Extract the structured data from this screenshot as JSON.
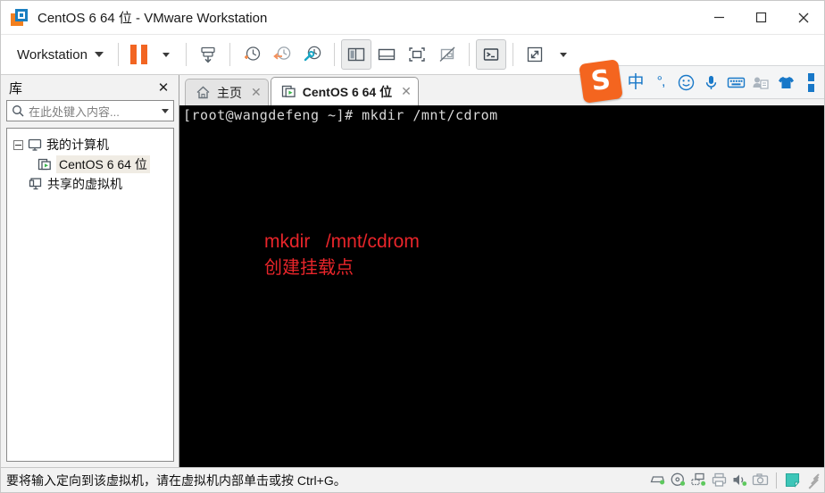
{
  "window": {
    "title": "CentOS 6 64 位 - VMware Workstation",
    "app_icon": "vmware-logo-icon",
    "controls": {
      "minimize": "minimize-icon",
      "maximize": "maximize-icon",
      "close": "close-icon"
    }
  },
  "toolbar": {
    "workstation_menu": "Workstation",
    "buttons": [
      {
        "name": "suspend-vm",
        "icon": "suspend-icon"
      },
      {
        "name": "take-snapshot",
        "icon": "snapshot-add-icon"
      },
      {
        "name": "revert-snapshot",
        "icon": "snapshot-revert-icon"
      },
      {
        "name": "snapshot-manager",
        "icon": "snapshot-manager-icon"
      },
      {
        "name": "show-library",
        "icon": "library-panel-icon",
        "pressed": true
      },
      {
        "name": "show-thumbnails",
        "icon": "thumbnail-bar-icon",
        "pressed": false
      },
      {
        "name": "fit-guest",
        "icon": "fit-guest-icon",
        "pressed": false
      },
      {
        "name": "autofit-off",
        "icon": "autofit-off-icon",
        "pressed": false
      },
      {
        "name": "console-view",
        "icon": "console-icon",
        "pressed": true
      },
      {
        "name": "enter-fullscreen",
        "icon": "fullscreen-icon",
        "pressed": false
      }
    ]
  },
  "ime": {
    "logo": "sogou-logo-icon",
    "logo_letter": "S",
    "mode_label": "中",
    "punct_label": "°,",
    "items": [
      {
        "name": "emoji-icon"
      },
      {
        "name": "microphone-icon"
      },
      {
        "name": "soft-keyboard-icon"
      },
      {
        "name": "clipboard-icon"
      },
      {
        "name": "skin-icon"
      },
      {
        "name": "menu-dots-icon"
      }
    ]
  },
  "sidebar": {
    "title": "库",
    "close_label": "✕",
    "search": {
      "placeholder": "在此处键入内容...",
      "value": "",
      "icon": "search-icon"
    },
    "tree": [
      {
        "label": "我的计算机",
        "icon": "my-computer-icon",
        "expanded": true,
        "selected": false
      },
      {
        "label": "CentOS 6 64 位",
        "icon": "vm-running-icon",
        "selected": true
      },
      {
        "label": "共享的虚拟机",
        "icon": "shared-vms-icon",
        "selected": false
      }
    ]
  },
  "tabs": [
    {
      "label": "主页",
      "icon": "home-icon",
      "active": false,
      "close": "✕"
    },
    {
      "label": "CentOS 6 64 位",
      "icon": "vm-running-icon",
      "active": true,
      "close": "✕"
    }
  ],
  "terminal": {
    "prompt_line": "[root@wangdefeng ~]# mkdir /mnt/cdrom",
    "background": "#000000",
    "text_color": "#d8d8d8"
  },
  "annotation": {
    "line1": "mkdir   /mnt/cdrom",
    "line2": "创建挂载点",
    "color": "#e8252a"
  },
  "statusbar": {
    "message": "要将输入定向到该虚拟机，请在虚拟机内部单击或按 Ctrl+G。",
    "devices": [
      {
        "name": "hard-disk-icon",
        "active": true
      },
      {
        "name": "cd-dvd-icon",
        "active": true
      },
      {
        "name": "network-adapter-icon",
        "active": true
      },
      {
        "name": "printer-icon",
        "active": false
      },
      {
        "name": "sound-card-icon",
        "active": true
      },
      {
        "name": "camera-icon",
        "active": false
      },
      {
        "name": "notes-icon",
        "active": false
      }
    ]
  },
  "colors": {
    "accent_orange": "#f26522",
    "accent_blue": "#1878c8",
    "annotation_red": "#e8252a",
    "device_active": "#5ec95e",
    "icon_gray": "#566069"
  }
}
